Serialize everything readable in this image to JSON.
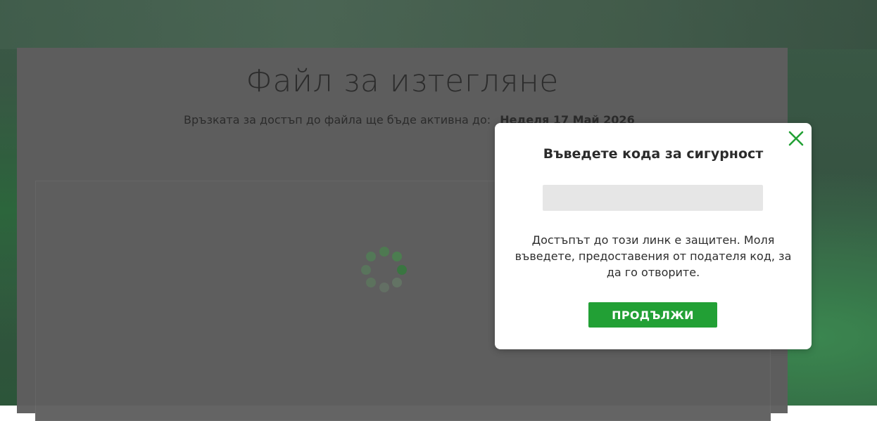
{
  "page": {
    "title": "Файл за изтегляне",
    "expiry_label": "Връзката за достъп до файла ще бъде активна до:",
    "expiry_date": "Неделя 17 Май 2026"
  },
  "modal": {
    "title": "Въведете кода за сигурност",
    "code_input": {
      "value": "",
      "placeholder": ""
    },
    "message": "Достъпът до този линк е защитен. Моля въведете, предоставения от подателя код, за да го отворите.",
    "continue_label": "ПРОДЪЛЖИ",
    "close_icon": "close-icon"
  },
  "colors": {
    "accent": "#22a035",
    "close_icon": "#22a035",
    "spinner": "#4e8d54"
  },
  "icons": {
    "loading": "loading-spinner-icon"
  }
}
